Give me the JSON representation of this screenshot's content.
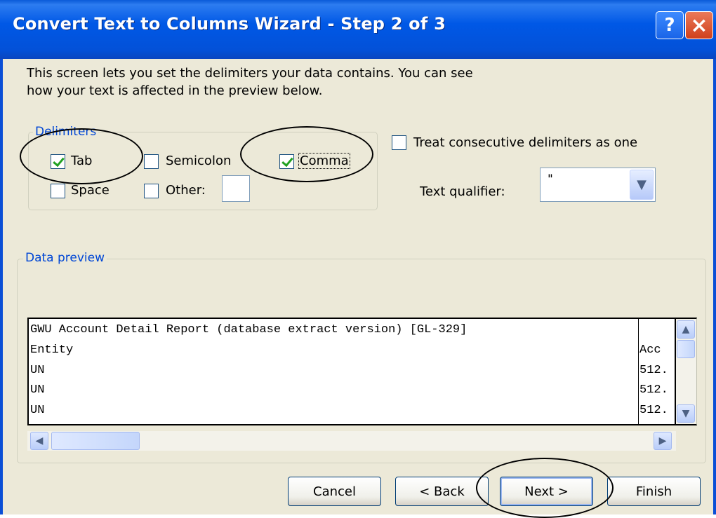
{
  "window": {
    "title": "Convert Text to Columns Wizard - Step 2 of 3",
    "help_label": "?",
    "close_label": "×"
  },
  "intro": {
    "line1": "This screen lets you set the delimiters your data contains.  You can see",
    "line2": "how your text is affected in the preview below."
  },
  "delimiters": {
    "title": "Delimiters",
    "options": [
      {
        "label": "Tab",
        "checked": true
      },
      {
        "label": "Semicolon",
        "checked": false
      },
      {
        "label": "Comma",
        "checked": true
      },
      {
        "label": "Space",
        "checked": false
      },
      {
        "label": "Other:",
        "checked": false
      }
    ],
    "other_value": ""
  },
  "consecutive": {
    "label": "Treat consecutive delimiters as one",
    "checked": false
  },
  "qualifier": {
    "label": "Text qualifier:",
    "value": "\""
  },
  "preview": {
    "title": "Data preview",
    "rows": [
      {
        "col1": "GWU Account Detail Report (database extract version) [GL-329]",
        "col2": ""
      },
      {
        "col1": "Entity",
        "col2": "Acc"
      },
      {
        "col1": "UN",
        "col2": "512."
      },
      {
        "col1": "UN",
        "col2": "512."
      },
      {
        "col1": "UN",
        "col2": "512."
      }
    ]
  },
  "buttons": {
    "cancel": "Cancel",
    "back": "< Back",
    "next": "Next >",
    "finish": "Finish"
  },
  "colors": {
    "titlebar": "#0058e6",
    "dialog_bg": "#ece9d8",
    "group_title": "#0046d5",
    "check": "#21a121"
  }
}
